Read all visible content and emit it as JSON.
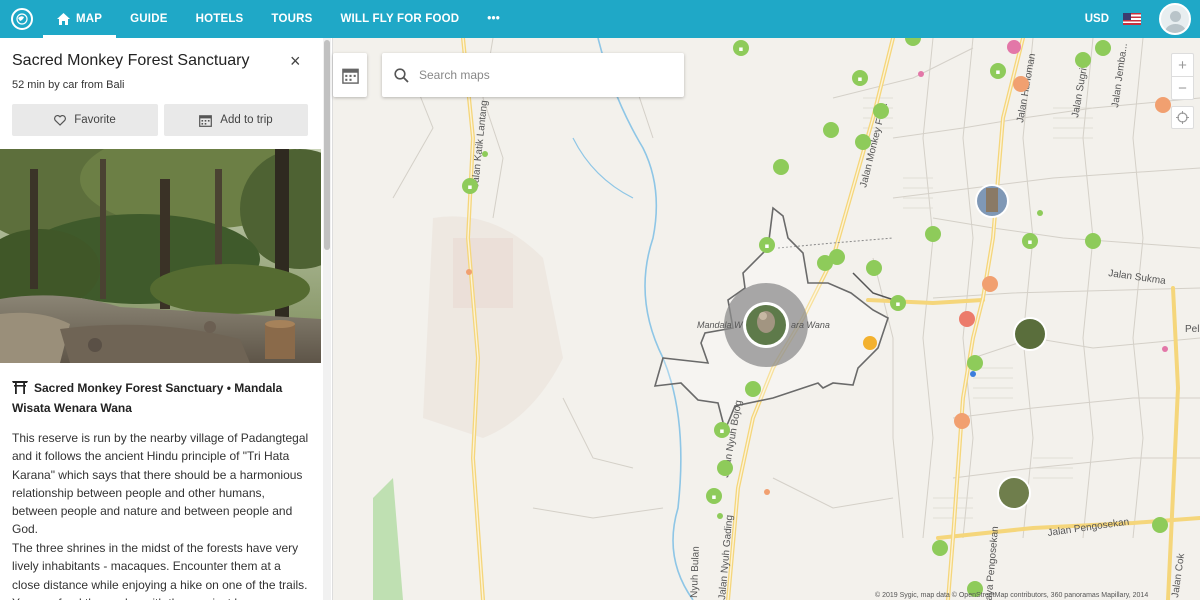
{
  "nav": {
    "logo_icon": "globe-logo-icon",
    "items": [
      {
        "label": "MAP",
        "icon": "home-icon",
        "active": true
      },
      {
        "label": "GUIDE"
      },
      {
        "label": "HOTELS"
      },
      {
        "label": "TOURS"
      },
      {
        "label": "WILL FLY FOR FOOD"
      }
    ],
    "more_label": "•••",
    "currency": "USD",
    "flag_icon": "us-flag-icon",
    "avatar_icon": "user-avatar-icon"
  },
  "sidebar": {
    "title": "Sacred Monkey Forest Sanctuary",
    "close_label": "×",
    "subtitle": "52 min by car from Bali",
    "favorite_label": "Favorite",
    "add_to_trip_label": "Add to trip",
    "heading_name": "Sacred Monkey Forest Sanctuary",
    "heading_sep": "•",
    "heading_alt": "Mandala Wisata Wenara Wana",
    "para1": "This reserve is run by the nearby village of Padangtegal and it follows the ancient Hindu principle of \"Tri Hata Karana\" which says that there should be a harmonious relationship between people and other humans, between people and nature and between people and God.",
    "para2": "The three shrines in the midst of the forests have very lively inhabitants - macaques. Encounter them at a close distance while enjoying a hike on one of the trails. You can feed them, play with them or just have a..."
  },
  "map": {
    "search_placeholder": "Search maps",
    "zoom_in": "+",
    "zoom_out": "−",
    "region_label_left": "Mandala W",
    "region_label_right": "ara Wana",
    "streets": {
      "katik": "Jalan Katik Lantang",
      "monkey": "Jalan Monkey For...",
      "hanoman": "Jalan Hanoman",
      "sugriwa": "Jalan Sugriwa",
      "jembawan": "Jalan Jemba...",
      "sukma": "Jalan Sukma",
      "pel": "Pel",
      "bojog": "Jalan Nyuh Bojog",
      "gading": "Jalan Nyuh Gading",
      "bulan": "Nyuh Bulan",
      "pengosekan": "Jalan Pengosekan",
      "raya": "Raya Pengosekan",
      "cok": "Jalan Cok"
    },
    "attribution": "© 2019 Sygic, map data © OpenStreetMap contributors, 360 panoramas Mapillary, 2014"
  },
  "colors": {
    "nav_bg": "#1fa8c7",
    "poi_green": "#8ecb5a",
    "poi_orange": "#f1a070",
    "poi_pink": "#e56b6b",
    "road_yellow": "#f5d67b",
    "water": "#8ec6e6"
  }
}
